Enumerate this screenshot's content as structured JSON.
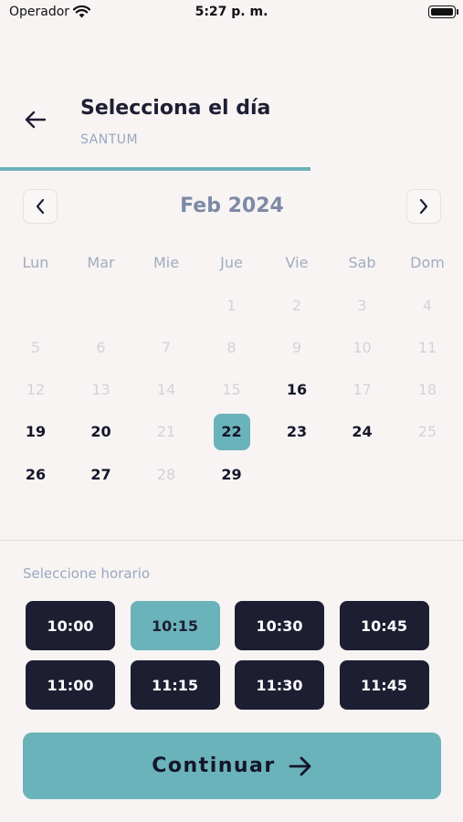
{
  "status_bar": {
    "carrier": "Operador",
    "time": "5:27 p. m."
  },
  "header": {
    "title": "Selecciona el día",
    "subtitle": "SANTUM",
    "progress": 0.67
  },
  "calendar": {
    "month_label": "Feb 2024",
    "weekdays": [
      "Lun",
      "Mar",
      "Mie",
      "Jue",
      "Vie",
      "Sab",
      "Dom"
    ],
    "weeks": [
      [
        {
          "d": ""
        },
        {
          "d": ""
        },
        {
          "d": ""
        },
        {
          "d": "1",
          "s": "disabled"
        },
        {
          "d": "2",
          "s": "disabled"
        },
        {
          "d": "3",
          "s": "disabled"
        },
        {
          "d": "4",
          "s": "disabled"
        }
      ],
      [
        {
          "d": "5",
          "s": "disabled"
        },
        {
          "d": "6",
          "s": "disabled"
        },
        {
          "d": "7",
          "s": "disabled"
        },
        {
          "d": "8",
          "s": "disabled"
        },
        {
          "d": "9",
          "s": "disabled"
        },
        {
          "d": "10",
          "s": "disabled"
        },
        {
          "d": "11",
          "s": "disabled"
        }
      ],
      [
        {
          "d": "12",
          "s": "disabled"
        },
        {
          "d": "13",
          "s": "disabled"
        },
        {
          "d": "14",
          "s": "disabled"
        },
        {
          "d": "15",
          "s": "disabled"
        },
        {
          "d": "16",
          "s": "enabled"
        },
        {
          "d": "17",
          "s": "disabled"
        },
        {
          "d": "18",
          "s": "disabled"
        }
      ],
      [
        {
          "d": "19",
          "s": "enabled"
        },
        {
          "d": "20",
          "s": "enabled"
        },
        {
          "d": "21",
          "s": "disabled"
        },
        {
          "d": "22",
          "s": "selected"
        },
        {
          "d": "23",
          "s": "enabled"
        },
        {
          "d": "24",
          "s": "enabled"
        },
        {
          "d": "25",
          "s": "disabled"
        }
      ],
      [
        {
          "d": "26",
          "s": "enabled"
        },
        {
          "d": "27",
          "s": "enabled"
        },
        {
          "d": "28",
          "s": "disabled"
        },
        {
          "d": "29",
          "s": "enabled"
        },
        {
          "d": ""
        },
        {
          "d": ""
        },
        {
          "d": ""
        }
      ]
    ]
  },
  "schedule": {
    "label": "Seleccione horario",
    "slots": [
      {
        "time": "10:00",
        "active": false
      },
      {
        "time": "10:15",
        "active": true
      },
      {
        "time": "10:30",
        "active": false
      },
      {
        "time": "10:45",
        "active": false
      },
      {
        "time": "11:00",
        "active": false
      },
      {
        "time": "11:15",
        "active": false
      },
      {
        "time": "11:30",
        "active": false
      },
      {
        "time": "11:45",
        "active": false
      }
    ]
  },
  "continue_button": {
    "label": "Continuar"
  },
  "colors": {
    "accent": "#6ab3ba",
    "dark": "#1e1e33",
    "background": "#f7f4f3",
    "muted": "#9aa7c0",
    "disabled": "#d2d2d8"
  }
}
